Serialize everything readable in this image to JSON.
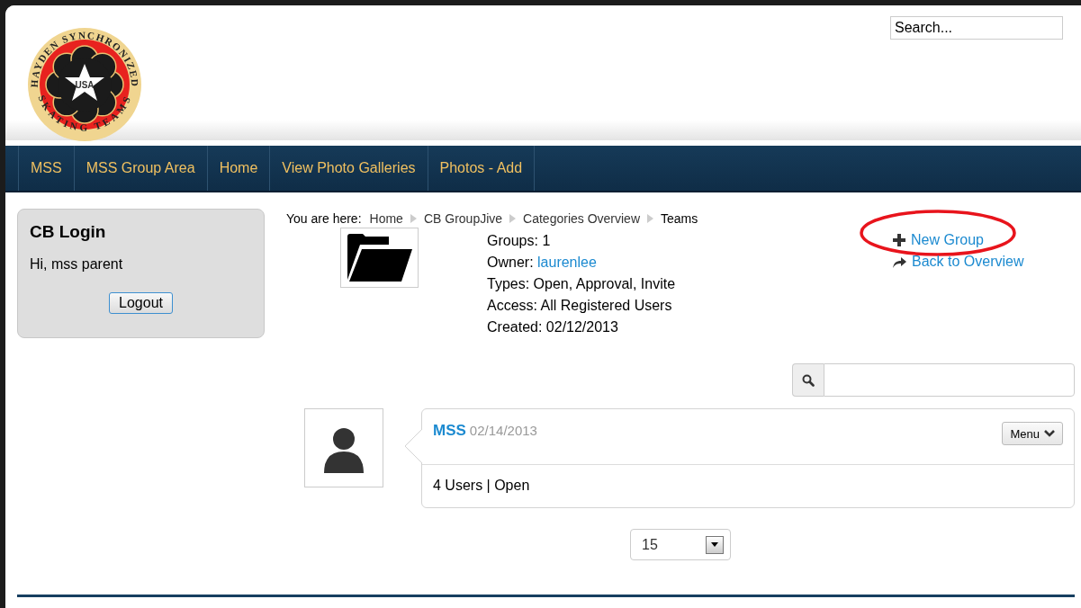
{
  "header": {
    "logo": {
      "top_text": "HAYDEN SYNCHRONIZED",
      "bottom_text": "SKATING TEAMS",
      "center_text": "USA"
    },
    "search": {
      "placeholder": "Search..."
    }
  },
  "nav": [
    {
      "label": "MSS"
    },
    {
      "label": "MSS Group Area"
    },
    {
      "label": "Home"
    },
    {
      "label": "View Photo Galleries"
    },
    {
      "label": "Photos - Add"
    }
  ],
  "login": {
    "title": "CB Login",
    "greeting": "Hi, mss parent",
    "button": "Logout"
  },
  "breadcrumb": {
    "label": "You are here:",
    "items": [
      {
        "label": "Home",
        "link": true
      },
      {
        "label": "CB GroupJive",
        "link": true
      },
      {
        "label": "Categories Overview",
        "link": true
      },
      {
        "label": "Teams",
        "link": false
      }
    ]
  },
  "category": {
    "details": [
      {
        "label": "Groups:",
        "value": "1",
        "link": false
      },
      {
        "label": "Owner:",
        "value": "laurenlee",
        "link": true
      },
      {
        "label": "Types:",
        "value": "Open, Approval, Invite",
        "link": false
      },
      {
        "label": "Access:",
        "value": "All Registered Users",
        "link": false
      },
      {
        "label": "Created:",
        "value": "02/12/2013",
        "link": false
      }
    ]
  },
  "actions": [
    {
      "kind": "add",
      "label": "New Group",
      "circled": true
    },
    {
      "kind": "back",
      "label": "Back to Overview",
      "circled": false
    }
  ],
  "groups": [
    {
      "name": "MSS",
      "date": "02/14/2013",
      "menu": "Menu",
      "summary": "4 Users | Open"
    }
  ],
  "pagination": {
    "value": "15"
  }
}
